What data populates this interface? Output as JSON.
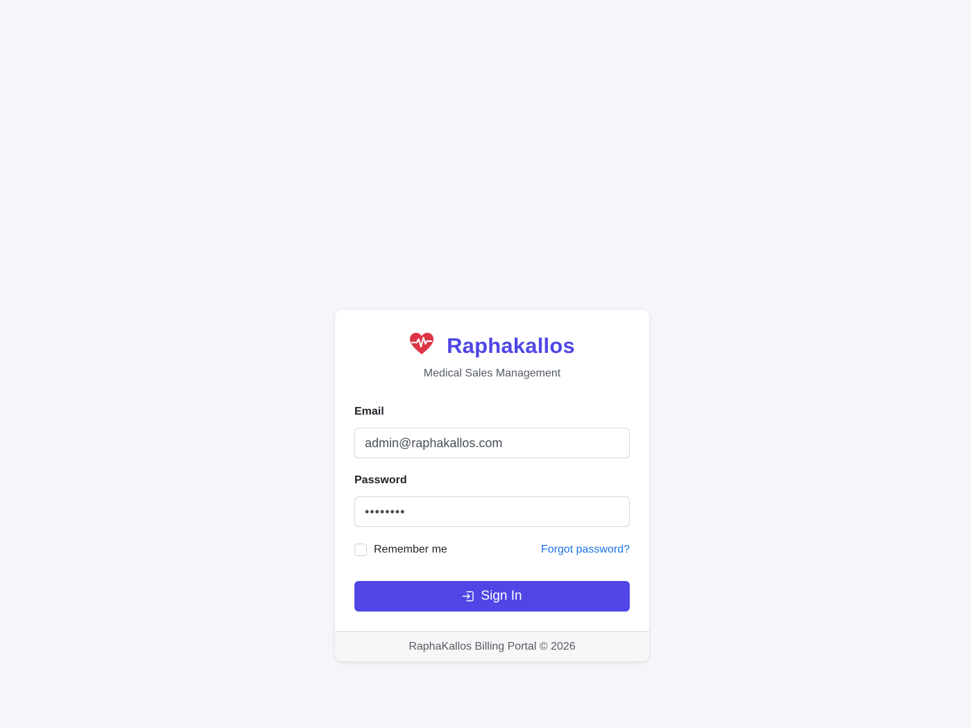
{
  "brand": {
    "icon": "heart-pulse-icon",
    "title": "Raphakallos",
    "subtitle": "Medical Sales Management",
    "icon_color": "#dc3545",
    "title_color": "#4f46e5"
  },
  "form": {
    "email": {
      "label": "Email",
      "value": "admin@raphakallos.com"
    },
    "password": {
      "label": "Password",
      "value": "••••••••"
    },
    "remember": {
      "label": "Remember me",
      "checked": false
    },
    "forgot_link": "Forgot password?",
    "submit": {
      "icon": "sign-in-icon",
      "label": "Sign In",
      "color": "#4f46e5"
    }
  },
  "footer": {
    "text": "RaphaKallos Billing Portal © 2026"
  }
}
